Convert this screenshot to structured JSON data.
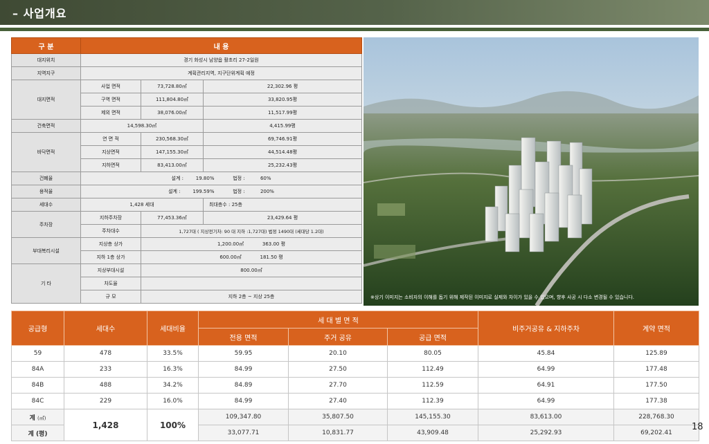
{
  "header": {
    "title": "사업개요"
  },
  "overview": {
    "col_header": "구 분",
    "content_header": "내 용",
    "site_location": {
      "label": "대지위치",
      "value": "경기 화성시 남양읍 활초리 27-2일원"
    },
    "zoning": {
      "label": "지역지구",
      "value": "계획관리지역, 지구단위계획 예정"
    },
    "site_area": {
      "label": "대지면적",
      "rows": [
        {
          "name": "사업 면적",
          "m2": "73,728.80㎡",
          "pyeong": "22,302.96 평"
        },
        {
          "name": "구역 면적",
          "m2": "111,804.80㎡",
          "pyeong": "33,820.95평"
        },
        {
          "name": "제외 면적",
          "m2": "38,076.00㎡",
          "pyeong": "11,517.99평"
        }
      ]
    },
    "building_area": {
      "label": "건축면적",
      "m2": "14,598.30㎡",
      "pyeong": "4,415.99평"
    },
    "floor_area": {
      "label": "바닥면적",
      "rows": [
        {
          "name": "연 면 적",
          "m2": "230,568.30㎡",
          "pyeong": "69,746.91평"
        },
        {
          "name": "지상면적",
          "m2": "147,155.30㎡",
          "pyeong": "44,514.48평"
        },
        {
          "name": "지하면적",
          "m2": "83,413.00㎡",
          "pyeong": "25,232.43평"
        }
      ]
    },
    "coverage": {
      "label": "건폐율",
      "design_label": "설계 :",
      "design": "19.80%",
      "legal_label": "법정 :",
      "legal": "60%"
    },
    "far": {
      "label": "용적율",
      "design_label": "설계 :",
      "design": "199.59%",
      "legal_label": "법정 :",
      "legal": "200%"
    },
    "households": {
      "label": "세대수",
      "value": "1,428 세대",
      "floors": "최대층수 : 25층"
    },
    "parking": {
      "label": "주차장",
      "area": {
        "name": "지하주차장",
        "m2": "77,453.36㎡",
        "pyeong": "23,429.64 평"
      },
      "count": {
        "name": "주차대수",
        "value": "1,727대 ( 지상전기차: 90 대 지하 :1,727대)  법정  1490대 (세대당 1.2대)"
      }
    },
    "amenity": {
      "label": "부대복리시설",
      "rows": [
        {
          "name": "지상층 상가",
          "m2": "1,200.00㎡",
          "pyeong": "363.00 평"
        },
        {
          "name": "지하 1층 상가",
          "m2": "600.00㎡",
          "pyeong": "181.50 평"
        }
      ]
    },
    "etc": {
      "label": "기 타",
      "rows": [
        {
          "name": "지상부대시설",
          "value": "800.00㎡"
        },
        {
          "name": "차도율",
          "value": ""
        },
        {
          "name": "규 모",
          "value": "지하 2층 ~ 지상 25층"
        }
      ]
    }
  },
  "photo": {
    "caption": "※상기 이미지는 소비자의 이해를 돕기 위해 제작된 이미지로 실제와 차이가 있을 수 있으며, 향후 사공 시 다소 변경될 수 있습니다."
  },
  "supply": {
    "headers": {
      "type": "공급형",
      "households": "세대수",
      "ratio": "세대비율",
      "area_group": "세 대 별 면 적",
      "exclusive": "전용 면적",
      "shared": "주거 공유",
      "supply": "공급 면적",
      "parking": "비주거공유 & 지하주차",
      "contract": "계약 면적"
    },
    "rows": [
      {
        "type": "59",
        "households": "478",
        "ratio": "33.5%",
        "exclusive": "59.95",
        "shared": "20.10",
        "supply": "80.05",
        "parking": "45.84",
        "contract": "125.89"
      },
      {
        "type": "84A",
        "households": "233",
        "ratio": "16.3%",
        "exclusive": "84.99",
        "shared": "27.50",
        "supply": "112.49",
        "parking": "64.99",
        "contract": "177.48"
      },
      {
        "type": "84B",
        "households": "488",
        "ratio": "34.2%",
        "exclusive": "84.89",
        "shared": "27.70",
        "supply": "112.59",
        "parking": "64.91",
        "contract": "177.50"
      },
      {
        "type": "84C",
        "households": "229",
        "ratio": "16.0%",
        "exclusive": "84.99",
        "shared": "27.40",
        "supply": "112.39",
        "parking": "64.99",
        "contract": "177.38"
      }
    ],
    "total_m2": {
      "label": "계",
      "unit": "(㎡)",
      "exclusive": "109,347.80",
      "shared": "35,807.50",
      "supply": "145,155.30",
      "parking": "83,613.00",
      "contract": "228,768.30"
    },
    "total_py": {
      "label": "계 (평)",
      "exclusive": "33,077.71",
      "shared": "10,831.77",
      "supply": "43,909.48",
      "parking": "25,292.93",
      "contract": "69,202.41"
    },
    "total_households": "1,428",
    "total_ratio": "100%"
  },
  "page_number": "18"
}
